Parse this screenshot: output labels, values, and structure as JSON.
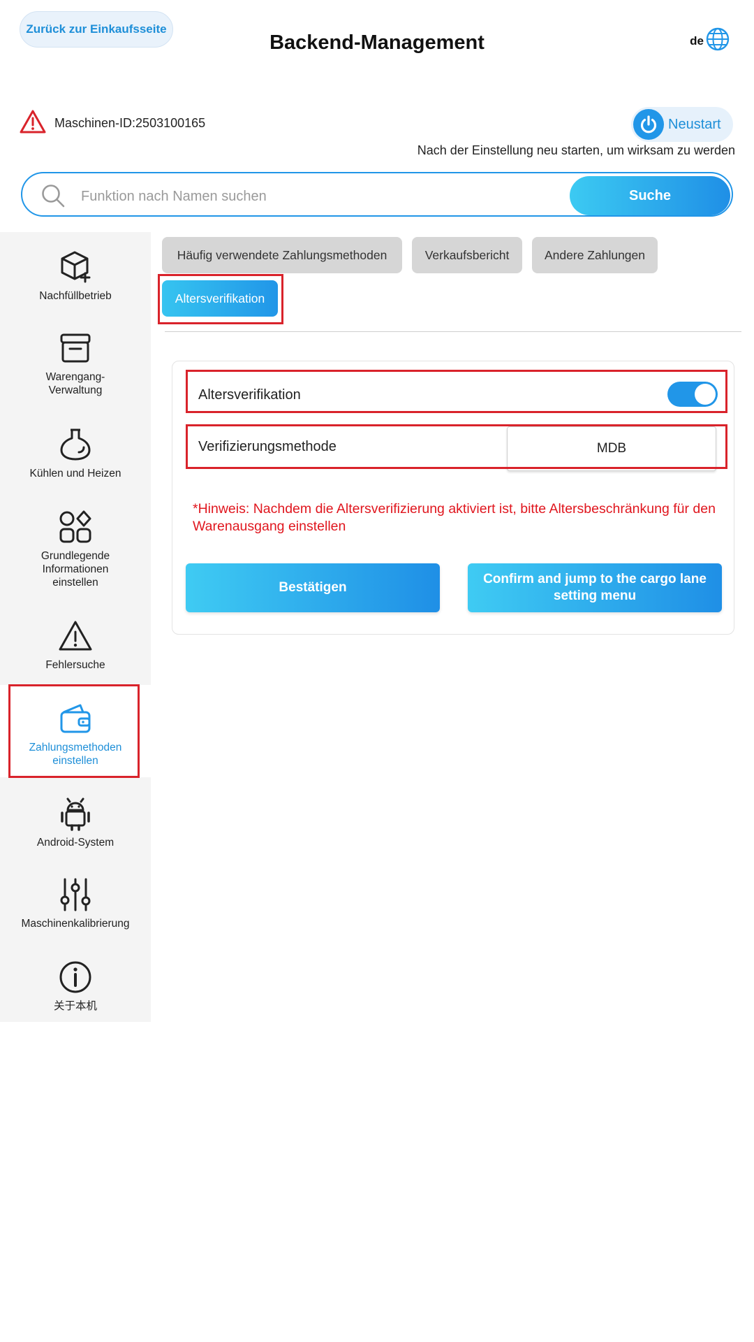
{
  "header": {
    "back_label": "Zurück zur Einkaufsseite",
    "title": "Backend-Management",
    "language": "de"
  },
  "machine": {
    "id_text": "Maschinen-ID:2503100165",
    "restart_label": "Neustart",
    "restart_note": "Nach der Einstellung neu starten, um wirksam zu werden"
  },
  "search": {
    "placeholder": "Funktion nach Namen suchen",
    "value": "",
    "button_label": "Suche"
  },
  "sidebar": {
    "items": [
      {
        "label": "Nachfüllbetrieb",
        "icon": "box-plus-icon"
      },
      {
        "label": "Warengang-Verwaltung",
        "icon": "archive-icon"
      },
      {
        "label": "Kühlen und Heizen",
        "icon": "flask-icon"
      },
      {
        "label": "Grundlegende Informationen einstellen",
        "icon": "grid-shapes-icon"
      },
      {
        "label": "Fehlersuche",
        "icon": "warning-icon"
      },
      {
        "label": "Zahlungsmethoden einstellen",
        "icon": "wallet-icon",
        "active": true
      },
      {
        "label": "Android-System",
        "icon": "android-icon"
      },
      {
        "label": "Maschinenkalibrierung",
        "icon": "sliders-icon"
      },
      {
        "label": "关于本机",
        "icon": "info-icon"
      }
    ]
  },
  "tabs": [
    {
      "label": "Häufig verwendete Zahlungsmethoden",
      "active": false
    },
    {
      "label": "Verkaufsbericht",
      "active": false
    },
    {
      "label": "Andere Zahlungen",
      "active": false
    },
    {
      "label": "Altersverifikation",
      "active": true
    }
  ],
  "age_verification": {
    "toggle_label": "Altersverifikation",
    "toggle_on": true,
    "method_label": "Verifizierungsmethode",
    "method_value": "MDB",
    "hint": "*Hinweis: Nachdem die Altersverifizierung aktiviert ist, bitte Altersbeschränkung für den Warenausgang einstellen",
    "confirm_label": "Bestätigen",
    "confirm_jump_label": "Confirm and jump to the cargo lane setting menu"
  },
  "colors": {
    "accent": "#2196e8",
    "highlight_red": "#d9232b",
    "hint_red": "#e0161e",
    "sidebar_bg": "#f4f4f4"
  }
}
